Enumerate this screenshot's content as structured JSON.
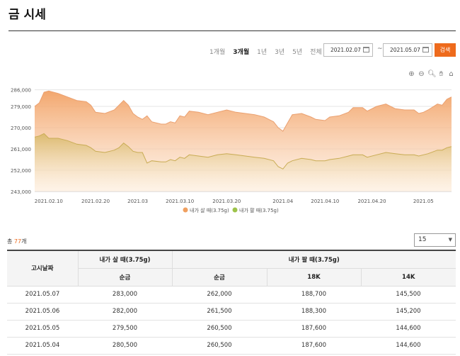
{
  "page": {
    "title": "금 시세"
  },
  "filters": {
    "tabs": [
      "1개월",
      "3개월",
      "1년",
      "3년",
      "5년",
      "전체"
    ],
    "active_tab": "3개월",
    "start_date": "2021.02.07",
    "separator": "~",
    "end_date": "2021.05.07",
    "search_label": "검색"
  },
  "chart_tools": [
    "zoom-in-icon",
    "zoom-out-icon",
    "magnifier-icon",
    "hand-pan-icon",
    "home-icon"
  ],
  "chart_data": {
    "type": "area",
    "x_ticks": [
      "2021.02.10",
      "2021.02.20",
      "2021.03",
      "2021.03.10",
      "2021.03.20",
      "2021.04",
      "2021.04.10",
      "2021.04.20",
      "2021.05"
    ],
    "y_ticks": [
      "286,000",
      "279,000",
      "270,000",
      "261,000",
      "252,000",
      "243,000"
    ],
    "ylim": [
      243000,
      288000
    ],
    "xlim": [
      "2021.02.07",
      "2021.05.07"
    ],
    "grid": true,
    "legend_position": "bottom",
    "series": [
      {
        "name": "내가 살 때(3.75g)",
        "color": "#f0a060",
        "points": [
          [
            "2021.02.07",
            279000
          ],
          [
            "2021.02.08",
            280500
          ],
          [
            "2021.02.09",
            285000
          ],
          [
            "2021.02.10",
            285500
          ],
          [
            "2021.02.12",
            284500
          ],
          [
            "2021.02.14",
            283000
          ],
          [
            "2021.02.16",
            281500
          ],
          [
            "2021.02.18",
            281000
          ],
          [
            "2021.02.19",
            279500
          ],
          [
            "2021.02.20",
            276500
          ],
          [
            "2021.02.22",
            276000
          ],
          [
            "2021.02.24",
            277500
          ],
          [
            "2021.02.25",
            279500
          ],
          [
            "2021.02.26",
            281500
          ],
          [
            "2021.02.27",
            279500
          ],
          [
            "2021.02.28",
            276000
          ],
          [
            "2021.03.01",
            274500
          ],
          [
            "2021.03.02",
            273500
          ],
          [
            "2021.03.03",
            275000
          ],
          [
            "2021.03.04",
            272500
          ],
          [
            "2021.03.06",
            271500
          ],
          [
            "2021.03.07",
            271500
          ],
          [
            "2021.03.08",
            272500
          ],
          [
            "2021.03.09",
            272000
          ],
          [
            "2021.03.10",
            275000
          ],
          [
            "2021.03.11",
            274500
          ],
          [
            "2021.03.12",
            277000
          ],
          [
            "2021.03.14",
            276500
          ],
          [
            "2021.03.16",
            275500
          ],
          [
            "2021.03.18",
            276500
          ],
          [
            "2021.03.20",
            277500
          ],
          [
            "2021.03.22",
            276500
          ],
          [
            "2021.03.24",
            276000
          ],
          [
            "2021.03.26",
            275500
          ],
          [
            "2021.03.28",
            274500
          ],
          [
            "2021.03.30",
            272500
          ],
          [
            "2021.03.31",
            270000
          ],
          [
            "2021.04.01",
            268500
          ],
          [
            "2021.04.02",
            272000
          ],
          [
            "2021.04.03",
            275500
          ],
          [
            "2021.04.05",
            276000
          ],
          [
            "2021.04.07",
            274500
          ],
          [
            "2021.04.08",
            273500
          ],
          [
            "2021.04.10",
            273000
          ],
          [
            "2021.04.11",
            274500
          ],
          [
            "2021.04.13",
            275000
          ],
          [
            "2021.04.15",
            276500
          ],
          [
            "2021.04.16",
            278500
          ],
          [
            "2021.04.18",
            278500
          ],
          [
            "2021.04.19",
            277000
          ],
          [
            "2021.04.21",
            279000
          ],
          [
            "2021.04.23",
            280000
          ],
          [
            "2021.04.25",
            278000
          ],
          [
            "2021.04.27",
            277500
          ],
          [
            "2021.04.29",
            277500
          ],
          [
            "2021.04.30",
            276000
          ],
          [
            "2021.05.01",
            276500
          ],
          [
            "2021.05.02",
            277500
          ],
          [
            "2021.05.04",
            280000
          ],
          [
            "2021.05.05",
            279500
          ],
          [
            "2021.05.06",
            282000
          ],
          [
            "2021.05.07",
            283000
          ]
        ]
      },
      {
        "name": "내가 팔 때(3.75g)",
        "color": "#9dc34a",
        "points": [
          [
            "2021.02.07",
            266000
          ],
          [
            "2021.02.08",
            266500
          ],
          [
            "2021.02.09",
            267500
          ],
          [
            "2021.02.10",
            265500
          ],
          [
            "2021.02.12",
            265500
          ],
          [
            "2021.02.14",
            264500
          ],
          [
            "2021.02.16",
            263000
          ],
          [
            "2021.02.18",
            262500
          ],
          [
            "2021.02.19",
            261500
          ],
          [
            "2021.02.20",
            260000
          ],
          [
            "2021.02.22",
            259500
          ],
          [
            "2021.02.24",
            260500
          ],
          [
            "2021.02.25",
            261500
          ],
          [
            "2021.02.26",
            263500
          ],
          [
            "2021.02.27",
            262000
          ],
          [
            "2021.02.28",
            260000
          ],
          [
            "2021.03.01",
            259500
          ],
          [
            "2021.03.02",
            259500
          ],
          [
            "2021.03.03",
            255000
          ],
          [
            "2021.03.04",
            256000
          ],
          [
            "2021.03.06",
            255500
          ],
          [
            "2021.03.07",
            255500
          ],
          [
            "2021.03.08",
            256500
          ],
          [
            "2021.03.09",
            256000
          ],
          [
            "2021.03.10",
            257500
          ],
          [
            "2021.03.11",
            257000
          ],
          [
            "2021.03.12",
            258500
          ],
          [
            "2021.03.14",
            258000
          ],
          [
            "2021.03.16",
            257500
          ],
          [
            "2021.03.18",
            258500
          ],
          [
            "2021.03.20",
            259000
          ],
          [
            "2021.03.22",
            258500
          ],
          [
            "2021.03.24",
            258000
          ],
          [
            "2021.03.26",
            257500
          ],
          [
            "2021.03.28",
            257000
          ],
          [
            "2021.03.30",
            256000
          ],
          [
            "2021.03.31",
            253500
          ],
          [
            "2021.04.01",
            252500
          ],
          [
            "2021.04.02",
            255000
          ],
          [
            "2021.04.03",
            256000
          ],
          [
            "2021.04.05",
            257000
          ],
          [
            "2021.04.07",
            256500
          ],
          [
            "2021.04.08",
            256000
          ],
          [
            "2021.04.10",
            256000
          ],
          [
            "2021.04.11",
            256500
          ],
          [
            "2021.04.13",
            257000
          ],
          [
            "2021.04.15",
            258000
          ],
          [
            "2021.04.16",
            258500
          ],
          [
            "2021.04.18",
            258500
          ],
          [
            "2021.04.19",
            257500
          ],
          [
            "2021.04.21",
            258500
          ],
          [
            "2021.04.23",
            259500
          ],
          [
            "2021.04.25",
            259000
          ],
          [
            "2021.04.27",
            258500
          ],
          [
            "2021.04.29",
            258500
          ],
          [
            "2021.04.30",
            258000
          ],
          [
            "2021.05.01",
            258500
          ],
          [
            "2021.05.02",
            259000
          ],
          [
            "2021.05.04",
            260500
          ],
          [
            "2021.05.05",
            260500
          ],
          [
            "2021.05.06",
            261500
          ],
          [
            "2021.05.07",
            262000
          ]
        ]
      }
    ]
  },
  "list": {
    "total_prefix": "총 ",
    "total_count": "77",
    "total_suffix": "개",
    "page_size": "15"
  },
  "table": {
    "col_date": "고시날짜",
    "group_buy": "내가 살 때(3.75g)",
    "group_sell": "내가 팔 때(3.75g)",
    "sub_buy_pure": "순금",
    "sub_sell_pure": "순금",
    "sub_18k": "18K",
    "sub_14k": "14K",
    "rows": [
      [
        "2021.05.07",
        "283,000",
        "262,000",
        "188,700",
        "145,500"
      ],
      [
        "2021.05.06",
        "282,000",
        "261,500",
        "188,300",
        "145,200"
      ],
      [
        "2021.05.05",
        "279,500",
        "260,500",
        "187,600",
        "144,600"
      ],
      [
        "2021.05.04",
        "280,500",
        "260,500",
        "187,600",
        "144,600"
      ]
    ]
  }
}
